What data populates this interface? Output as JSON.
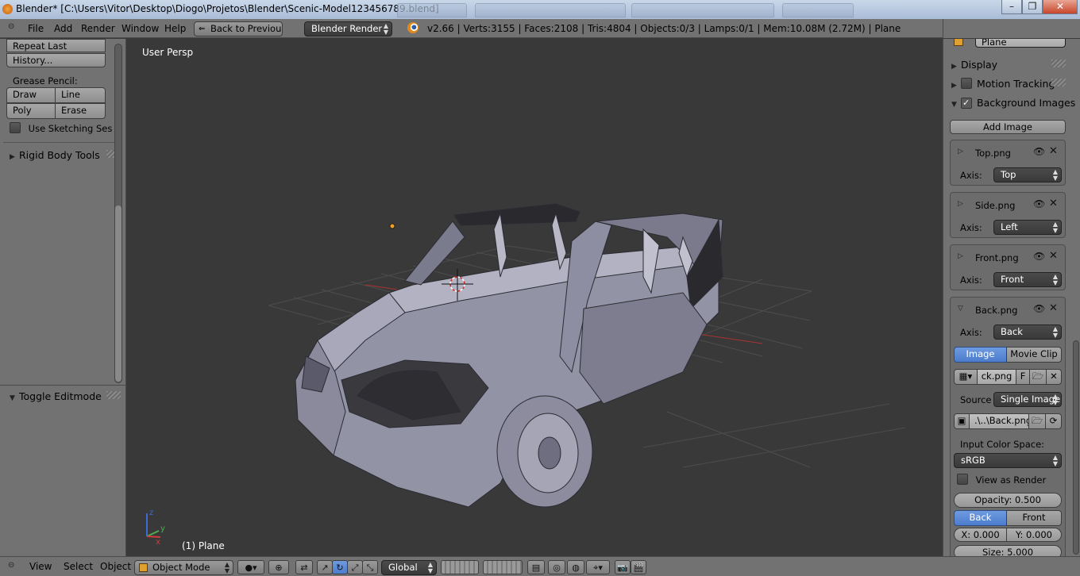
{
  "window": {
    "title": "Blender* [C:\\Users\\Vitor\\Desktop\\Diogo\\Projetos\\Blender\\Scenic-Model123456789.blend]",
    "minimize": "–",
    "maximize": "❐",
    "close": "✕"
  },
  "info_header": {
    "menus": [
      "File",
      "Add",
      "Render",
      "Window",
      "Help"
    ],
    "back_button": "Back to Previous",
    "render_engine": "Blender Render",
    "stats": "v2.66 | Verts:3155 | Faces:2108 | Tris:4804 | Objects:0/3 | Lamps:0/1 | Mem:10.08M (2.72M) | Plane"
  },
  "tool_shelf": {
    "repeat_last": "Repeat Last",
    "history": "History...",
    "grease_pencil_label": "Grease Pencil:",
    "draw": "Draw",
    "line": "Line",
    "poly": "Poly",
    "erase": "Erase",
    "use_sketching": "Use Sketching Sessi",
    "rigid_body_tools": "Rigid Body Tools",
    "toggle_editmode": "Toggle Editmode"
  },
  "viewport": {
    "view_name": "User Persp",
    "object_label": "(1) Plane",
    "axis_x": "x",
    "axis_y": "y",
    "axis_z": "z"
  },
  "properties": {
    "object_name": "Plane",
    "display": "Display",
    "motion_tracking": "Motion Tracking",
    "background_images": "Background Images",
    "add_image": "Add Image",
    "axis_label": "Axis:",
    "images": [
      {
        "name": "Top.png",
        "axis": "Top"
      },
      {
        "name": "Side.png",
        "axis": "Left"
      },
      {
        "name": "Front.png",
        "axis": "Front"
      },
      {
        "name": "Back.png",
        "axis": "Back"
      }
    ],
    "image_tab": "Image",
    "movie_clip_tab": "Movie Clip",
    "image_datablock": "ck.png",
    "fake_user": "F",
    "source_label": "Source",
    "source_value": "Single Image",
    "filepath": ".\\..\\Back.png",
    "input_color_space_label": "Input Color Space:",
    "color_space": "sRGB",
    "view_as_render": "View as Render",
    "opacity": "Opacity: 0.500",
    "back_option": "Back",
    "front_option": "Front",
    "x_offset": "X: 0.000",
    "y_offset": "Y: 0.000",
    "size": "Size: 5.000"
  },
  "view3d_header": {
    "menus": [
      "View",
      "Select",
      "Object"
    ],
    "mode": "Object Mode",
    "orientation": "Global"
  },
  "colors": {
    "panel_bg": "#727272",
    "viewport_bg": "#393939",
    "selected_blue": "#5680c2",
    "x_axis": "#d23c3c",
    "y_axis": "#4caf50",
    "z_axis": "#3a6bd6"
  }
}
